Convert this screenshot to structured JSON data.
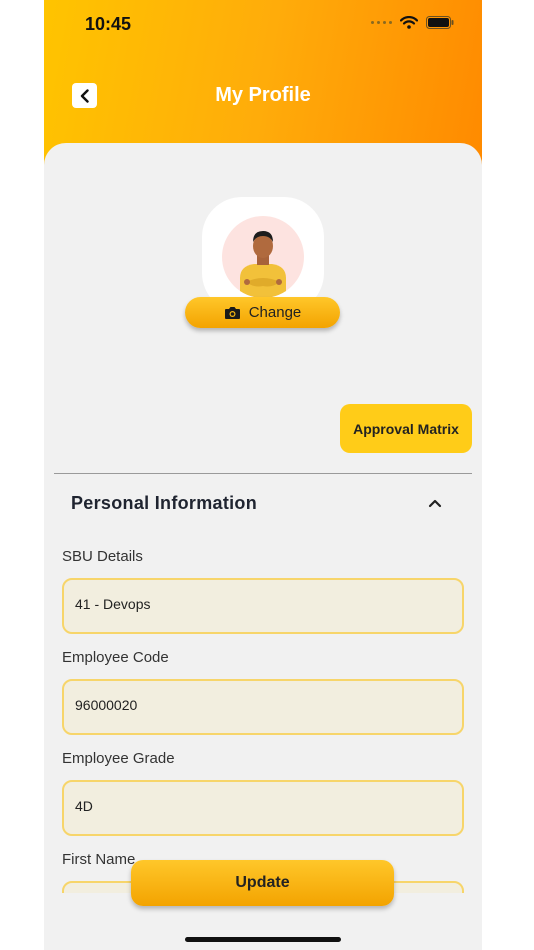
{
  "status_bar": {
    "time": "10:45"
  },
  "header": {
    "title": "My Profile",
    "back_icon": "chevron-left-icon"
  },
  "profile": {
    "change_label": "Change",
    "camera_icon": "camera-icon"
  },
  "approval_matrix_label": "Approval Matrix",
  "section": {
    "title": "Personal Information",
    "expanded": true,
    "toggle_icon": "chevron-up-icon"
  },
  "fields": [
    {
      "label": "SBU Details",
      "value": "41 - Devops"
    },
    {
      "label": "Employee Code",
      "value": "96000020"
    },
    {
      "label": "Employee Grade",
      "value": "4D"
    },
    {
      "label": "First Name",
      "value": ""
    }
  ],
  "update_label": "Update",
  "colors": {
    "header_gradient_start": "#ffc400",
    "header_gradient_end": "#ff8a00",
    "accent": "#ffcc18",
    "field_border": "#f7d56a",
    "field_background": "#f2eedf"
  }
}
